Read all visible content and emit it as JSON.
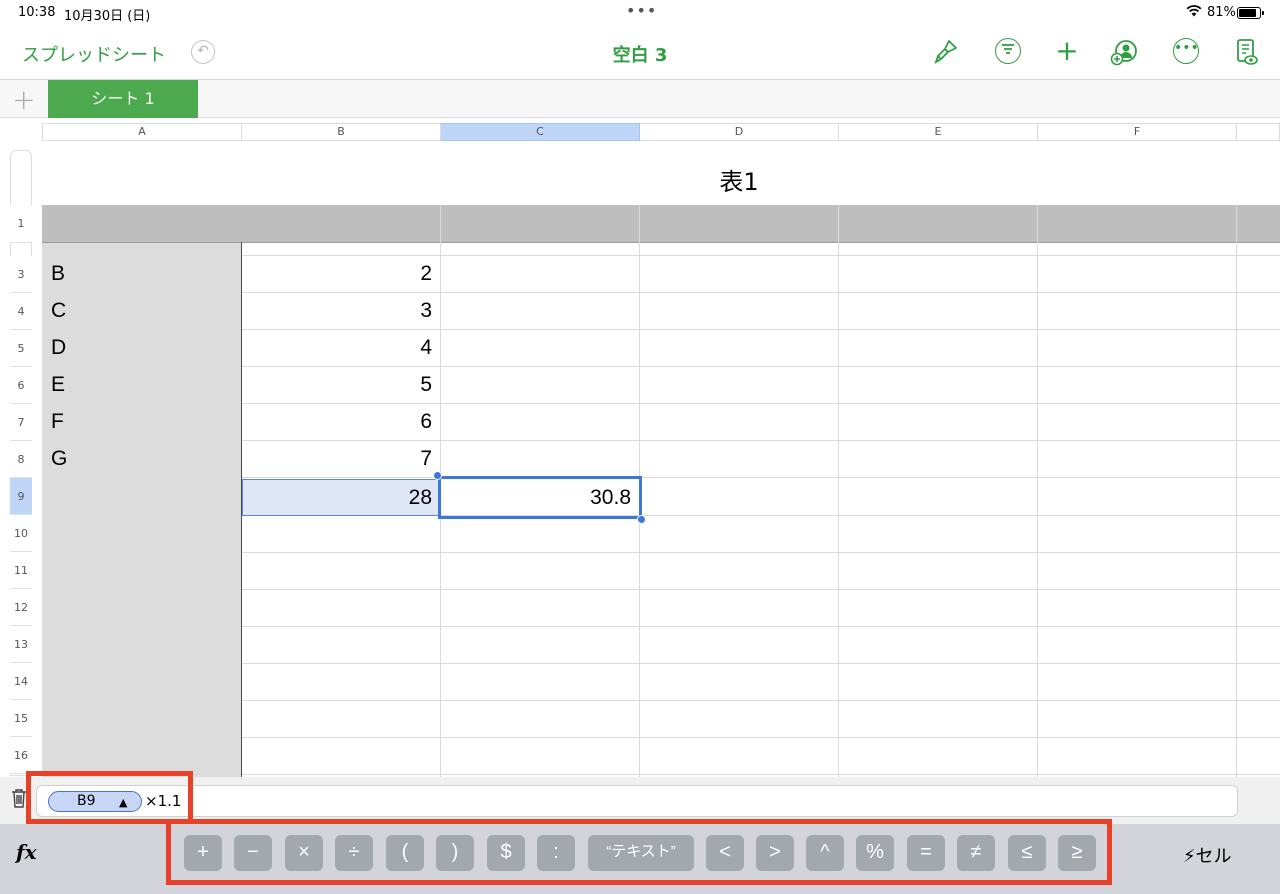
{
  "status": {
    "time": "10:38",
    "date": "10月30日 (日)",
    "dots": "•••",
    "battery": "81%"
  },
  "toolbar": {
    "back": "スプレッドシート",
    "title": "空白 3"
  },
  "tabs": {
    "sheet": "シート 1"
  },
  "columns": [
    "A",
    "B",
    "C",
    "D",
    "E",
    "F"
  ],
  "rows": [
    "1",
    "3",
    "4",
    "5",
    "6",
    "7",
    "8",
    "9",
    "10",
    "11",
    "12",
    "13",
    "14",
    "15",
    "16"
  ],
  "table": {
    "title": "表1",
    "partial_A": "A",
    "partial_B": "1",
    "labels": [
      "B",
      "C",
      "D",
      "E",
      "F",
      "G"
    ],
    "values": [
      "2",
      "3",
      "4",
      "5",
      "6",
      "7"
    ],
    "sum": "28",
    "result": "30.8"
  },
  "formula": {
    "ref": "B9",
    "ref_arrow": "▲",
    "expr": "×1.1"
  },
  "keys": [
    "+",
    "−",
    "×",
    "÷",
    "(",
    ")",
    "$",
    ":",
    "“テキスト”",
    "<",
    ">",
    "^",
    "%",
    "=",
    "≠",
    "≤",
    "≥"
  ],
  "keyboard": {
    "fx": "fx",
    "cell_button": "セル"
  },
  "colors": {
    "accent": "#2f9e41",
    "selection": "#3d78d8",
    "highlight": "#e8412a"
  }
}
